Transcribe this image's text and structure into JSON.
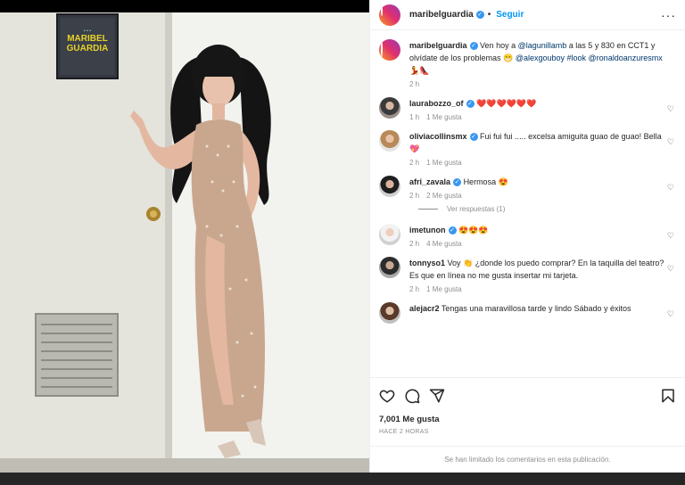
{
  "post": {
    "username": "maribelguardia",
    "follow_label": "Seguir",
    "more_label": "···",
    "sign_line1": "MARIBEL",
    "sign_line2": "GUARDIA",
    "caption_text": "Ven hoy a",
    "caption_mention1": "@lagunillamb",
    "caption_text2": "a las 5 y 830 en CCT1 y olvídate de los problemas",
    "caption_emoji1": "😁",
    "caption_mention2": "@alexgouboy",
    "caption_tag": "#look",
    "caption_mention3": "@ronaldoanzuresmx",
    "caption_emoji2": "💃👠",
    "caption_time": "2 h",
    "likes": "7,001 Me gusta",
    "posted": "HACE 2 HORAS",
    "comments_off": "Se han limitado los comentarios en esta publicación."
  },
  "comments": [
    {
      "user": "laurabozzo_of",
      "verified": true,
      "text": "❤️❤️❤️❤️❤️❤️",
      "time": "1 h",
      "likes": "1 Me gusta"
    },
    {
      "user": "oliviacollinsmx",
      "verified": true,
      "text": "Fui fui fui ..... excelsa amiguita guao de guao! Bella 💖",
      "time": "2 h",
      "likes": "1 Me gusta"
    },
    {
      "user": "afri_zavala",
      "verified": true,
      "text": "Hermosa 😍",
      "time": "2 h",
      "likes": "2 Me gusta",
      "replies": "Ver respuestas (1)"
    },
    {
      "user": "imetunon",
      "verified": true,
      "text": "😍😍😍",
      "time": "2 h",
      "likes": "4 Me gusta"
    },
    {
      "user": "tonnyso1",
      "verified": false,
      "text": "Voy 👏 ¿donde los puedo comprar? En la taquilla del teatro? Es que en línea no me gusta insertar mi tarjeta.",
      "time": "2 h",
      "likes": "1 Me gusta"
    },
    {
      "user": "alejacr2",
      "verified": false,
      "text": "Tengas una maravillosa tarde y lindo Sábado y éxitos",
      "time": "",
      "likes": ""
    }
  ]
}
